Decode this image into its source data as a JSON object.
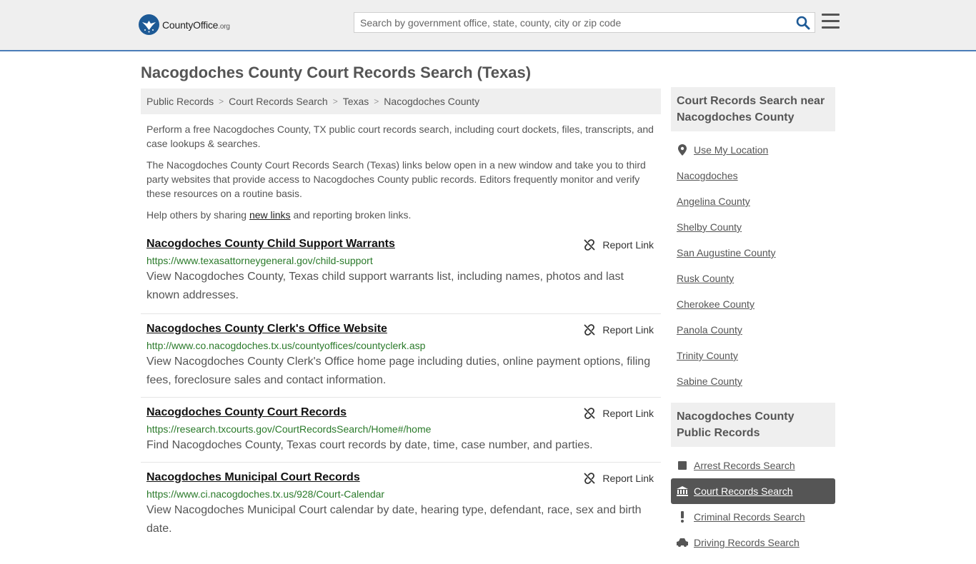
{
  "header": {
    "logo_main": "CountyOffice",
    "logo_suffix": ".org",
    "search_placeholder": "Search by government office, state, county, city or zip code"
  },
  "page_title": "Nacogdoches County Court Records Search (Texas)",
  "breadcrumb": [
    "Public Records",
    "Court Records Search",
    "Texas",
    "Nacogdoches County"
  ],
  "intro": {
    "p1": "Perform a free Nacogdoches County, TX public court records search, including court dockets, files, transcripts, and case lookups & searches.",
    "p2": "The Nacogdoches County Court Records Search (Texas) links below open in a new window and take you to third party websites that provide access to Nacogdoches County public records. Editors frequently monitor and verify these resources on a routine basis.",
    "p3_before": "Help others by sharing ",
    "p3_link": "new links",
    "p3_after": " and reporting broken links."
  },
  "report_label": "Report Link",
  "listings": [
    {
      "title": "Nacogdoches County Child Support Warrants",
      "url": "https://www.texasattorneygeneral.gov/child-support",
      "desc": "View Nacogdoches County, Texas child support warrants list, including names, photos and last known addresses."
    },
    {
      "title": "Nacogdoches County Clerk's Office Website",
      "url": "http://www.co.nacogdoches.tx.us/countyoffices/countyclerk.asp",
      "desc": "View Nacogdoches County Clerk's Office home page including duties, online payment options, filing fees, foreclosure sales and contact information."
    },
    {
      "title": "Nacogdoches County Court Records",
      "url": "https://research.txcourts.gov/CourtRecordsSearch/Home#/home",
      "desc": "Find Nacogdoches County, Texas court records by date, time, case number, and parties."
    },
    {
      "title": "Nacogdoches Municipal Court Records",
      "url": "https://www.ci.nacogdoches.tx.us/928/Court-Calendar",
      "desc": "View Nacogdoches Municipal Court calendar by date, hearing type, defendant, race, sex and birth date."
    }
  ],
  "sidebar": {
    "nearby_title": "Court Records Search near Nacogdoches County",
    "use_location": "Use My Location",
    "nearby": [
      "Nacogdoches",
      "Angelina County",
      "Shelby County",
      "San Augustine County",
      "Rusk County",
      "Cherokee County",
      "Panola County",
      "Trinity County",
      "Sabine County"
    ],
    "records_title": "Nacogdoches County Public Records",
    "records": [
      "Arrest Records Search",
      "Court Records Search",
      "Criminal Records Search",
      "Driving Records Search"
    ]
  },
  "colors": {
    "accent": "#4a7db8",
    "link_green": "#2a7a2a",
    "logo_blue": "#1d5a96"
  }
}
